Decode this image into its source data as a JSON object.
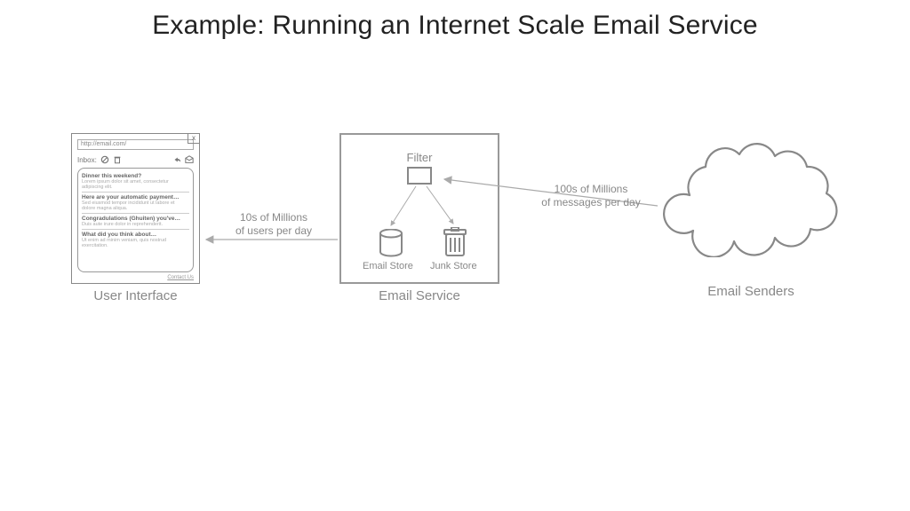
{
  "title": "Example: Running an Internet Scale Email Service",
  "ui": {
    "url": "http://email.com/",
    "close": "x",
    "inbox_label": "Inbox:",
    "contact": "Contact Us",
    "messages": [
      {
        "subject": "Dinner this weekend?",
        "preview": "Lorem ipsum dolor sit amet, consectetur adipiscing elit."
      },
      {
        "subject": "Here are your automatic payment…",
        "preview": "Sed eiusmod tempor incididunt ut labore et dolore magna aliqua."
      },
      {
        "subject": "Congradulations (Ghuiten) you've…",
        "preview": "Duis aute irure dolor in reprehenderit."
      },
      {
        "subject": "What did you think about…",
        "preview": "Ut enim ad minim veniam, quis nostrud exercitation."
      }
    ],
    "caption": "User Interface"
  },
  "service": {
    "filter_label": "Filter",
    "store_label": "Email Store",
    "junk_label": "Junk Store",
    "caption": "Email Service"
  },
  "senders": {
    "caption": "Email Senders"
  },
  "arrows": {
    "users": "10s of Millions\nof users per day",
    "messages": "100s of Millions\nof messages per day"
  }
}
